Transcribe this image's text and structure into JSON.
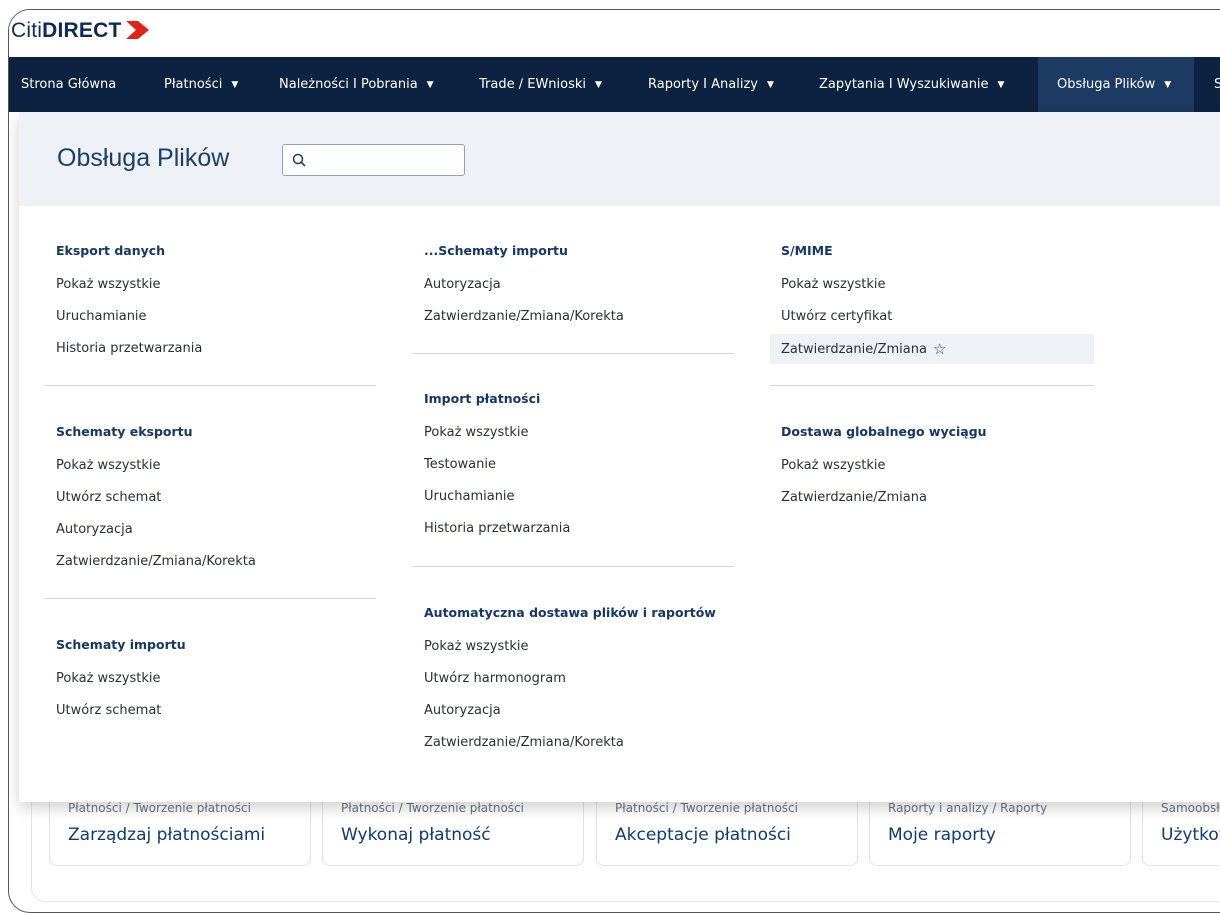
{
  "brand": {
    "logo_light": "Citi",
    "logo_bold": "DIRECT"
  },
  "nav": [
    {
      "label": "Strona Główna",
      "caret": false
    },
    {
      "label": "Płatności",
      "caret": true
    },
    {
      "label": "Należności I Pobrania",
      "caret": true
    },
    {
      "label": "Trade / EWnioski",
      "caret": true
    },
    {
      "label": "Raporty I Analizy",
      "caret": true
    },
    {
      "label": "Zapytania I Wyszukiwanie",
      "caret": true
    },
    {
      "label": "Obsługa Plików",
      "caret": true,
      "active": true
    },
    {
      "label": "S",
      "caret": false
    }
  ],
  "panel": {
    "title": "Obsługa Plików",
    "search_value": "",
    "col1": {
      "export": {
        "heading": "Eksport danych",
        "items": [
          "Pokaż wszystkie",
          "Uruchamianie",
          "Historia przetwarzania"
        ]
      },
      "export_schemes": {
        "heading": "Schematy eksportu",
        "items": [
          "Pokaż wszystkie",
          "Utwórz schemat",
          "Autoryzacja",
          "Zatwierdzanie/Zmiana/Korekta"
        ]
      },
      "import_schemes": {
        "heading": "Schematy importu",
        "items": [
          "Pokaż wszystkie",
          "Utwórz schemat"
        ]
      }
    },
    "col2": {
      "import_schemes_cont": {
        "heading": "...Schematy importu",
        "items": [
          "Autoryzacja",
          "Zatwierdzanie/Zmiana/Korekta"
        ]
      },
      "payment_import": {
        "heading": "Import płatności",
        "items": [
          "Pokaż wszystkie",
          "Testowanie",
          "Uruchamianie",
          "Historia przetwarzania"
        ]
      },
      "auto_delivery": {
        "heading": "Automatyczna dostawa plików i raportów",
        "items": [
          "Pokaż wszystkie",
          "Utwórz harmonogram",
          "Autoryzacja",
          "Zatwierdzanie/Zmiana/Korekta"
        ]
      }
    },
    "col3": {
      "smime": {
        "heading": "S/MIME",
        "items": [
          "Pokaż wszystkie",
          "Utwórz certyfikat",
          "Zatwierdzanie/Zmiana"
        ]
      },
      "global_statement": {
        "heading": "Dostawa globalnego wyciągu",
        "items": [
          "Pokaż wszystkie",
          "Zatwierdzanie/Zmiana"
        ]
      }
    }
  },
  "cards": [
    {
      "sub": "Płatności / Tworzenie płatności",
      "title": "Zarządzaj płatnościami"
    },
    {
      "sub": "Płatności / Tworzenie płatności",
      "title": "Wykonaj płatność"
    },
    {
      "sub": "Płatności / Tworzenie płatności",
      "title": "Akceptacje płatności"
    },
    {
      "sub": "Raporty i analizy / Raporty",
      "title": "Moje raporty"
    },
    {
      "sub": "Samoobsługa",
      "title": "Użytkownicy"
    }
  ],
  "colors": {
    "nav_bg": "#0d2240",
    "nav_active": "#1c3a62",
    "accent": "#14366b",
    "logo_red": "#e2231a"
  }
}
